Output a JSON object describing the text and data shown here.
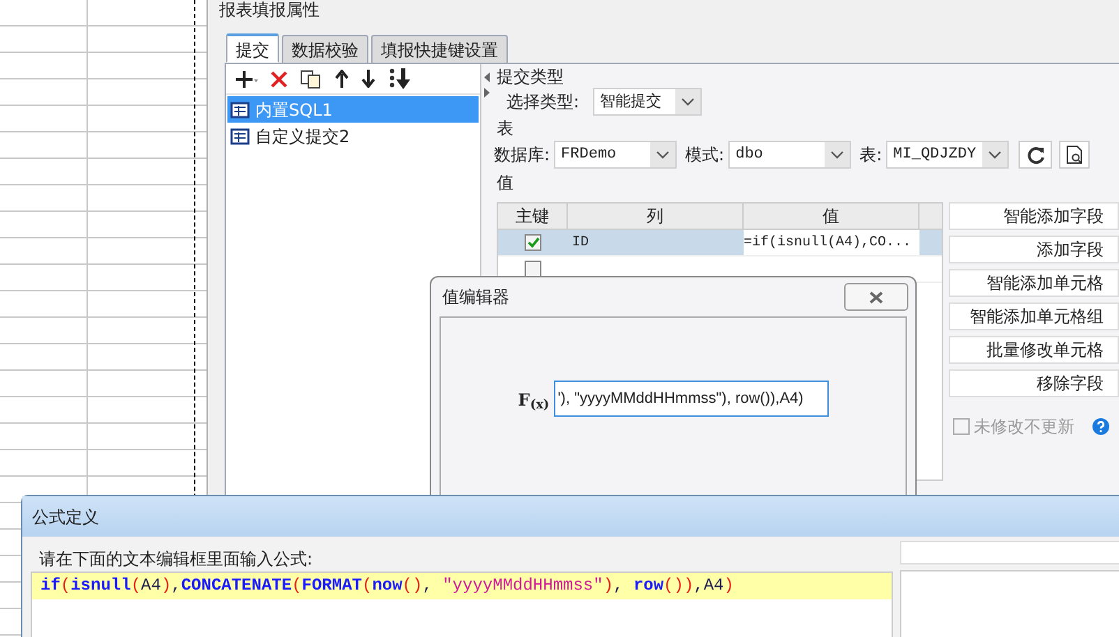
{
  "main_dialog": {
    "title": "报表填报属性",
    "tabs": [
      {
        "label": "提交",
        "selected": true
      },
      {
        "label": "数据校验",
        "selected": false
      },
      {
        "label": "填报快捷键设置",
        "selected": false
      }
    ],
    "submit_list": [
      {
        "label": "内置SQL1",
        "selected": true
      },
      {
        "label": "自定义提交2",
        "selected": false
      }
    ],
    "submit_type": {
      "heading": "提交类型",
      "label": "选择类型:",
      "value": "智能提交"
    },
    "table_section": {
      "heading": "表",
      "database_label": "数据库:",
      "database": "FRDemo",
      "schema_label": "模式:",
      "schema": "dbo",
      "table_label": "表:",
      "table": "MI_QDJZDY"
    },
    "values_section": {
      "heading": "值",
      "columns": [
        "主键",
        "列",
        "值"
      ],
      "rows": [
        {
          "key": true,
          "column": "ID",
          "value": "=if(isnull(A4),CO...",
          "selected": true
        },
        {
          "key": false,
          "selected": false
        }
      ]
    },
    "buttons": [
      "智能添加字段",
      "添加字段",
      "智能添加单元格",
      "智能添加单元格组",
      "批量修改单元格",
      "移除字段"
    ],
    "unchanged_no_update": {
      "label": "未修改不更新",
      "checked": false
    }
  },
  "value_editor": {
    "title": "值编辑器",
    "formula_icon": "F$_{(x)}$",
    "formula_value": "'), \"yyyyMMddHHmmss\"), row()),A4)"
  },
  "formula_dialog": {
    "title": "公式定义",
    "prompt": "请在下面的文本编辑框里面输入公式:",
    "formula_tokens": [
      {
        "kind": "fn",
        "text": "if"
      },
      {
        "kind": "paren",
        "text": "("
      },
      {
        "kind": "fn",
        "text": "isnull"
      },
      {
        "kind": "paren",
        "text": "("
      },
      {
        "kind": "plain",
        "text": "A4"
      },
      {
        "kind": "paren",
        "text": ")"
      },
      {
        "kind": "plain",
        "text": ","
      },
      {
        "kind": "fn",
        "text": "CONCATENATE"
      },
      {
        "kind": "paren",
        "text": "("
      },
      {
        "kind": "fn",
        "text": "FORMAT"
      },
      {
        "kind": "paren",
        "text": "("
      },
      {
        "kind": "fn",
        "text": "now"
      },
      {
        "kind": "paren",
        "text": "()"
      },
      {
        "kind": "plain",
        "text": ", "
      },
      {
        "kind": "string",
        "text": "\"yyyyMMddHHmmss\""
      },
      {
        "kind": "paren",
        "text": ")"
      },
      {
        "kind": "plain",
        "text": ", "
      },
      {
        "kind": "fn",
        "text": "row"
      },
      {
        "kind": "paren",
        "text": "()"
      },
      {
        "kind": "paren",
        "text": ")"
      },
      {
        "kind": "plain",
        "text": ",A4"
      },
      {
        "kind": "paren",
        "text": ")"
      }
    ]
  }
}
